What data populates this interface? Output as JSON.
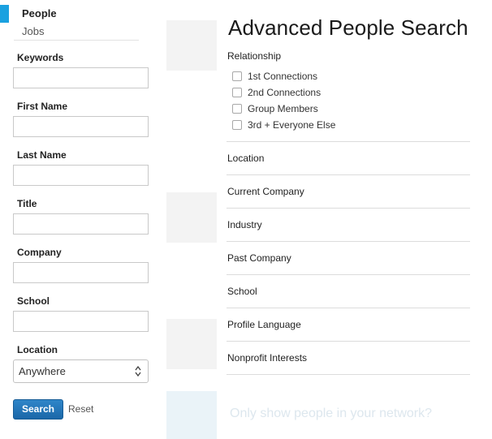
{
  "sidebar": {
    "tabs": [
      {
        "label": "People",
        "active": true
      },
      {
        "label": "Jobs",
        "active": false
      }
    ],
    "accent_color": "#1aa1e0",
    "fields": [
      {
        "label": "Keywords",
        "value": ""
      },
      {
        "label": "First Name",
        "value": ""
      },
      {
        "label": "Last Name",
        "value": ""
      },
      {
        "label": "Title",
        "value": ""
      },
      {
        "label": "Company",
        "value": ""
      },
      {
        "label": "School",
        "value": ""
      }
    ],
    "location": {
      "label": "Location",
      "selected": "Anywhere"
    },
    "search_label": "Search",
    "reset_label": "Reset"
  },
  "panel": {
    "title": "Advanced People Search",
    "relationship": {
      "label": "Relationship",
      "options": [
        {
          "label": "1st Connections",
          "checked": false
        },
        {
          "label": "2nd Connections",
          "checked": false
        },
        {
          "label": "Group Members",
          "checked": false
        },
        {
          "label": "3rd + Everyone Else",
          "checked": false
        }
      ]
    },
    "facets": [
      "Location",
      "Current Company",
      "Industry",
      "Past Company",
      "School",
      "Profile Language",
      "Nonprofit Interests"
    ]
  },
  "background": {
    "banner_text": "Only show people in your network?"
  }
}
